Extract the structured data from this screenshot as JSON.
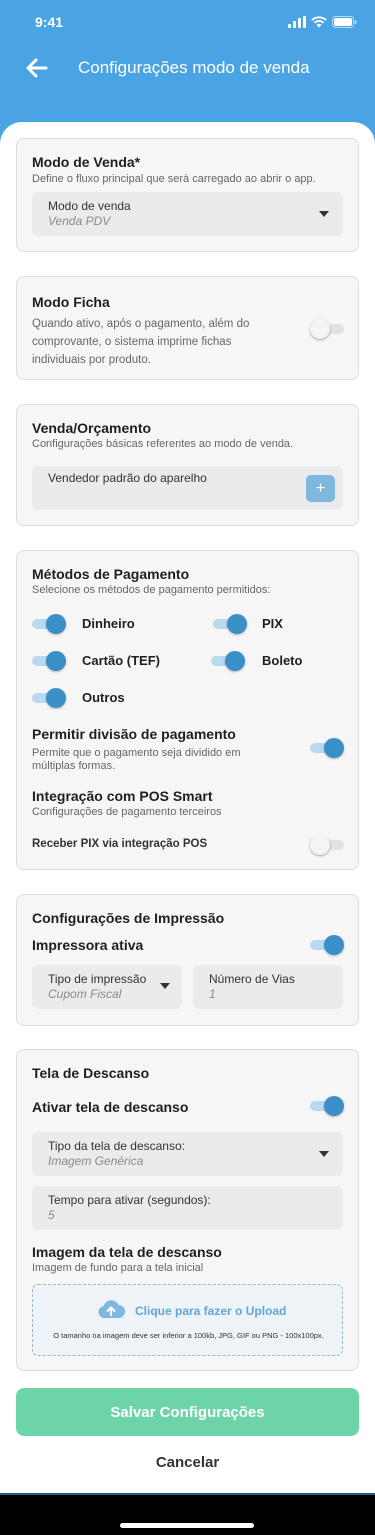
{
  "status_bar": {
    "time": "9:41"
  },
  "header": {
    "title": "Configurações modo de venda"
  },
  "sales_mode": {
    "title": "Modo de Venda*",
    "subtitle": "Define o fluxo principal que será carregado ao abrir o app.",
    "field_label": "Modo de venda",
    "field_value": "Venda PDV"
  },
  "ticket_mode": {
    "title": "Modo Ficha",
    "description": "Quando ativo, após o pagamento, além do comprovante, o sistema imprime fichas individuais por produto.",
    "enabled": false
  },
  "sale_quote": {
    "title": "Venda/Orçamento",
    "subtitle": "Configurações básicas referentes ao modo de venda.",
    "seller_label": "Vendedor padrão do aparelho",
    "add_symbol": "+"
  },
  "payment_methods": {
    "title": "Métodos de Pagamento",
    "subtitle": "Selecione os métodos de pagamento permitidos:",
    "methods": [
      {
        "label": "Dinheiro",
        "enabled": true
      },
      {
        "label": "PIX",
        "enabled": true
      },
      {
        "label": "Cartão (TEF)",
        "enabled": true
      },
      {
        "label": "Boleto",
        "enabled": true
      },
      {
        "label": "Outros",
        "enabled": true
      }
    ],
    "split_title": "Permitir divisão de pagamento",
    "split_description": "Permite que o pagamento seja dividido em múltiplas formas.",
    "split_enabled": true,
    "pos_title": "Integração com POS Smart",
    "pos_subtitle": "Configurações de pagamento terceiros",
    "pos_pix_label": "Receber PIX via integração POS",
    "pos_pix_enabled": false
  },
  "printing": {
    "title": "Configurações de Impressão",
    "printer_label": "Impressora ativa",
    "printer_enabled": true,
    "print_type_label": "Tipo de impressão",
    "print_type_value": "Cupom Fiscal",
    "copies_label": "Número de Vias",
    "copies_value": "1"
  },
  "screensaver": {
    "title": "Tela de Descanso",
    "enable_label": "Ativar tela de descanso",
    "enabled": true,
    "type_label": "Tipo da tela de descanso:",
    "type_value": "Imagem Genérica",
    "time_label": "Tempo para ativar (segundos):",
    "time_value": "5",
    "image_title": "Imagem da tela de descanso",
    "image_subtitle": "Imagem de fundo para a tela inicial",
    "upload_label": "Clique para fazer o Upload",
    "upload_hint": "O tamanho na imagem deve ser inferior a 100kb, JPG, GIF ou PNG - 100x100px."
  },
  "actions": {
    "save_label": "Salvar Configurações",
    "cancel_label": "Cancelar"
  },
  "colors": {
    "primary": "#4aa3e3",
    "toggle_on": "#3a8fc8",
    "save_button": "#6dd4a8"
  }
}
